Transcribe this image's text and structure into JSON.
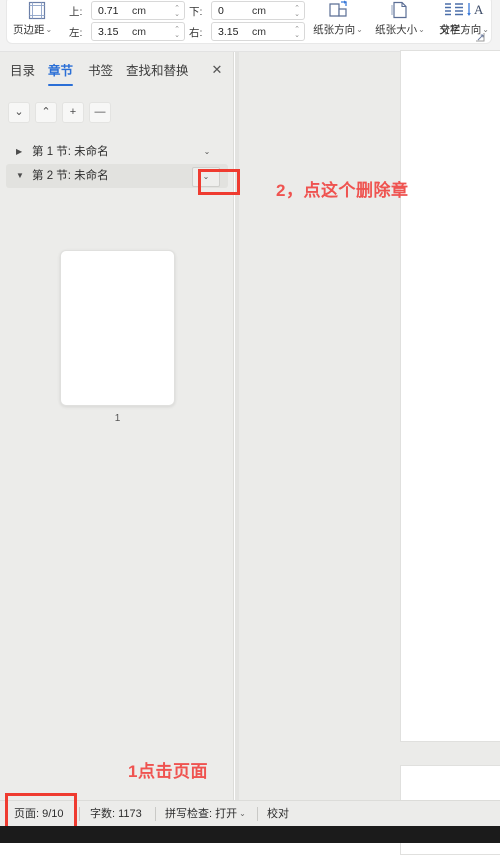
{
  "ribbon": {
    "margins": {
      "label": "页边距",
      "icon": "page-margins-icon",
      "caret": "⌄"
    },
    "fields": [
      {
        "name": "top",
        "label": "上:",
        "value": "0.71",
        "unit": "cm"
      },
      {
        "name": "bottom",
        "label": "下:",
        "value": "0",
        "unit": "cm"
      },
      {
        "name": "left",
        "label": "左:",
        "value": "3.15",
        "unit": "cm"
      },
      {
        "name": "right",
        "label": "右:",
        "value": "3.15",
        "unit": "cm"
      }
    ],
    "groups": [
      {
        "name": "orientation",
        "label": "纸张方向",
        "icon": "page-orientation-icon",
        "caret": "⌄"
      },
      {
        "name": "paper-size",
        "label": "纸张大小",
        "icon": "paper-size-icon",
        "caret": "⌄"
      },
      {
        "name": "columns",
        "label": "分栏",
        "icon": "columns-icon",
        "caret": "⌄"
      },
      {
        "name": "text-direction",
        "label": "文字方向",
        "icon": "text-direction-icon",
        "caret": "⌄"
      }
    ],
    "expander": "⌐"
  },
  "navpanel": {
    "tabs": [
      {
        "label": "目录",
        "active": false
      },
      {
        "label": "章节",
        "active": true
      },
      {
        "label": "书签",
        "active": false
      },
      {
        "label": "查找和替换",
        "active": false
      }
    ],
    "close_label": "✕",
    "tools": [
      {
        "name": "next-section-button",
        "glyph": "⌄"
      },
      {
        "name": "prev-section-button",
        "glyph": "⌃"
      },
      {
        "name": "add-section-button",
        "glyph": "+"
      },
      {
        "name": "remove-section-button",
        "glyph": "—"
      }
    ],
    "tree": [
      {
        "label": "第 1 节: 未命名",
        "arrow": "▶",
        "expanded": false,
        "selected": false,
        "menu": "⌄"
      },
      {
        "label": "第 2 节: 未命名",
        "arrow": "▼",
        "expanded": true,
        "selected": true,
        "menu": "⌄"
      }
    ],
    "thumbnail": {
      "page_number": "1"
    }
  },
  "annotations": [
    {
      "name": "annotation-delete-section",
      "text": "2，点这个删除章",
      "color": "#ef5350"
    },
    {
      "name": "annotation-click-page",
      "text": "1点击页面",
      "color": "#ef5350"
    }
  ],
  "statusbar": {
    "page": "页面: 9/10",
    "words": "字数: 1173",
    "spellcheck": "拼写检查: 打开",
    "spellcheck_caret": "⌄",
    "proofread": "校对"
  },
  "colors": {
    "accent": "#2b6fd6",
    "annotation_red": "#ef5350",
    "highlight_box": "#ef3b30",
    "panel_bg": "#ececea",
    "canvas_bg": "#ebebe9"
  }
}
